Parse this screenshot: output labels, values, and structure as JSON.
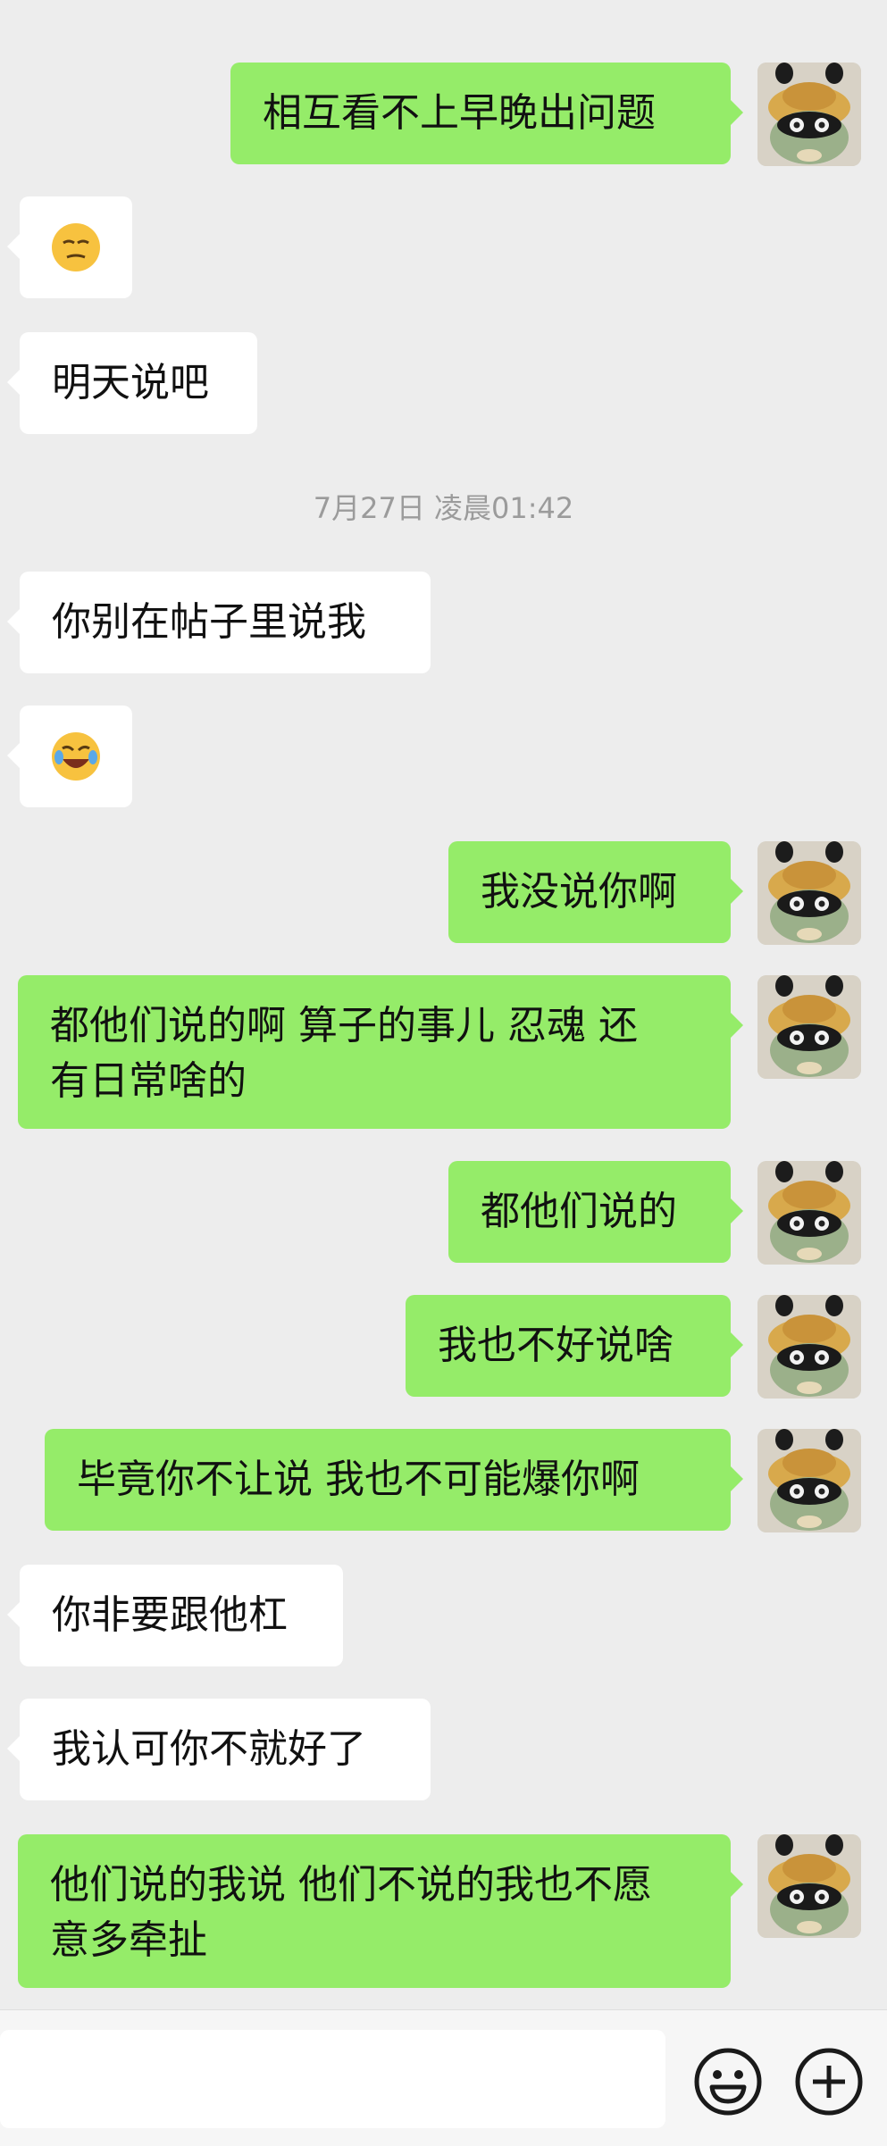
{
  "messages": [
    {
      "sender": "me",
      "text": "相互看不上早晚出问题"
    },
    {
      "sender": "other",
      "emoji": "unamused-face"
    },
    {
      "sender": "other",
      "text": "明天说吧"
    },
    {
      "sender": "other",
      "text": "你别在帖子里说我"
    },
    {
      "sender": "other",
      "emoji": "rolling-on-floor-laughing"
    },
    {
      "sender": "me",
      "text": "我没说你啊"
    },
    {
      "sender": "me",
      "text": "都他们说的啊 算子的事儿 忍魂 还\n有日常啥的"
    },
    {
      "sender": "me",
      "text": "都他们说的"
    },
    {
      "sender": "me",
      "text": "我也不好说啥"
    },
    {
      "sender": "me",
      "text": "毕竟你不让说 我也不可能爆你啊"
    },
    {
      "sender": "other",
      "text": "你非要跟他杠"
    },
    {
      "sender": "other",
      "text": "我认可你不就好了"
    },
    {
      "sender": "me",
      "text": "他们说的我说 他们不说的我也不愿\n意多牵扯"
    }
  ],
  "timestamp": "7月27日 凌晨01:42",
  "toolbar": {
    "input_value": "",
    "emoji_icon": "smiley-face-icon",
    "plus_icon": "plus-circle-icon"
  },
  "colors": {
    "background": "#ededed",
    "my_bubble": "#95ec69",
    "their_bubble": "#ffffff",
    "timestamp_text": "#9b9b9b"
  }
}
